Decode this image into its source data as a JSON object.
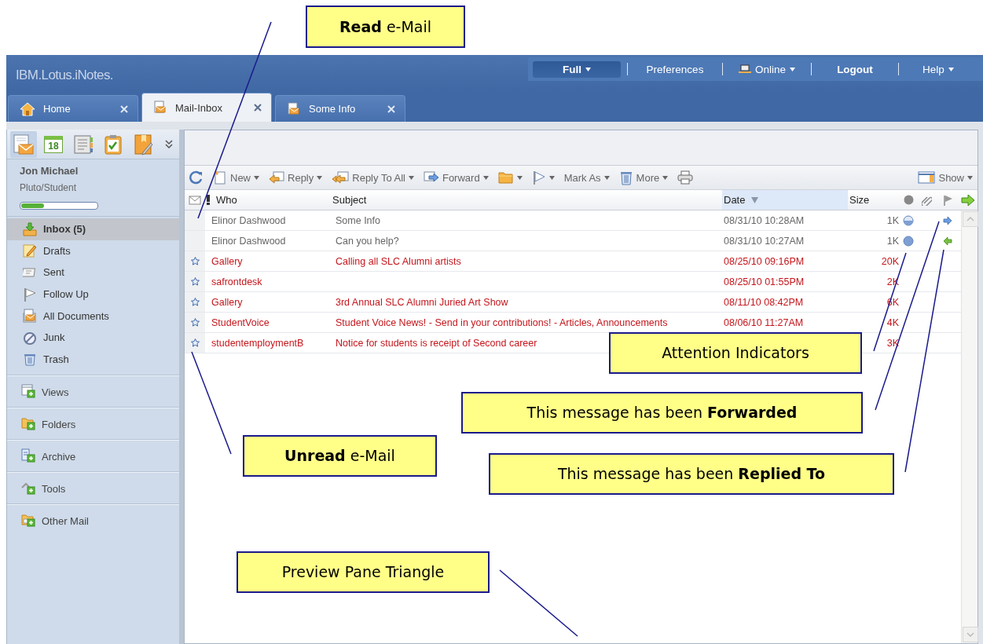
{
  "header": {
    "logo": "IBM.Lotus.iNotes.",
    "nav": [
      {
        "label": "Full",
        "kind": "pill"
      },
      {
        "label": "Preferences",
        "kind": "link"
      },
      {
        "label": "Online",
        "kind": "status"
      },
      {
        "label": "Logout",
        "kind": "strong"
      },
      {
        "label": "Help",
        "kind": "menu"
      }
    ]
  },
  "tabs": [
    {
      "label": "Home",
      "kind": "home",
      "selected": false
    },
    {
      "label": "Mail-Inbox",
      "kind": "mail",
      "selected": true
    },
    {
      "label": "Some Info",
      "kind": "mail",
      "selected": false
    }
  ],
  "sidebar": {
    "apps": [
      {
        "kind": "mail",
        "selected": true
      },
      {
        "kind": "calendar",
        "label": "18",
        "selected": false
      },
      {
        "kind": "contacts",
        "selected": false
      },
      {
        "kind": "todo",
        "selected": false
      },
      {
        "kind": "notebook",
        "selected": false
      }
    ],
    "user": {
      "name": "Jon Michael",
      "org": "Pluto/Student"
    },
    "quota": {
      "level": 0.3
    },
    "nav": [
      {
        "label": "Inbox (5)",
        "kind": "inbox",
        "selected": true
      },
      {
        "label": "Drafts",
        "kind": "drafts",
        "selected": false
      },
      {
        "label": "Sent",
        "kind": "sent",
        "selected": false
      },
      {
        "label": "Follow Up",
        "kind": "followup",
        "selected": false
      },
      {
        "label": "All Documents",
        "kind": "alldocs",
        "selected": false
      },
      {
        "label": "Junk",
        "kind": "junk",
        "selected": false
      },
      {
        "label": "Trash",
        "kind": "trash",
        "selected": false
      }
    ],
    "sections": [
      {
        "label": "Views",
        "kind": "views"
      },
      {
        "label": "Folders",
        "kind": "folders"
      },
      {
        "label": "Archive",
        "kind": "archive"
      },
      {
        "label": "Tools",
        "kind": "tools"
      },
      {
        "label": "Other Mail",
        "kind": "othermail"
      }
    ]
  },
  "toolbar": {
    "items": [
      {
        "kind": "refresh",
        "menu": false
      },
      {
        "kind": "new",
        "label": "New",
        "menu": true
      },
      {
        "kind": "reply",
        "label": "Reply",
        "menu": true
      },
      {
        "kind": "replyall",
        "label": "Reply To All",
        "menu": true
      },
      {
        "kind": "forward",
        "label": "Forward",
        "menu": true
      },
      {
        "kind": "folder",
        "menu": true
      },
      {
        "kind": "flag",
        "menu": true
      },
      {
        "kind": "markas",
        "label": "Mark As",
        "menu": true
      },
      {
        "kind": "delete",
        "label": "More",
        "menu": true
      },
      {
        "kind": "print",
        "menu": false
      }
    ],
    "show": {
      "label": "Show"
    }
  },
  "columns": [
    {
      "label": "Who",
      "kind": "who",
      "sorted": false
    },
    {
      "label": "Subject",
      "kind": "subject",
      "sorted": false
    },
    {
      "label": "Date",
      "kind": "date",
      "sorted": true
    },
    {
      "label": "Size",
      "kind": "size",
      "sorted": false
    }
  ],
  "messages": [
    {
      "who": "Elinor Dashwood",
      "subject": "Some Info",
      "date": "08/31/10 10:28AM",
      "size": "1K",
      "unread": false,
      "attention": {
        "kind": "half"
      },
      "forwarded": true,
      "replied": false
    },
    {
      "who": "Elinor Dashwood",
      "subject": "Can you help?",
      "date": "08/31/10 10:27AM",
      "size": "1K",
      "unread": false,
      "attention": {
        "kind": "full"
      },
      "forwarded": false,
      "replied": true
    },
    {
      "who": "Gallery",
      "subject": "Calling all SLC Alumni artists",
      "date": "08/25/10 09:16PM",
      "size": "20K",
      "unread": true,
      "forwarded": false,
      "replied": false
    },
    {
      "who": "safrontdesk",
      "date": "08/25/10 01:55PM",
      "size": "2K",
      "unread": true,
      "forwarded": false,
      "replied": false
    },
    {
      "who": "Gallery",
      "subject": "3rd Annual SLC Alumni Juried Art Show",
      "date": "08/11/10 08:42PM",
      "size": "6K",
      "unread": true,
      "forwarded": false,
      "replied": false
    },
    {
      "who": "StudentVoice",
      "subject": "Student Voice News! - Send in your contributions! - Articles, Announcements",
      "date": "08/06/10 11:27AM",
      "size": "4K",
      "unread": true,
      "forwarded": false,
      "replied": false
    },
    {
      "who": "studentemploymentB",
      "subject": "Notice for students is receipt of Second career",
      "size": "3K",
      "unread": true,
      "forwarded": false,
      "replied": false
    }
  ],
  "callouts": [
    {
      "text": "**Read** e-Mail"
    },
    {
      "text": "Attention Indicators"
    },
    {
      "text": "This message has been **Forwarded**"
    },
    {
      "text": "This message has been **Replied To**"
    },
    {
      "text": "**Unread** e-Mail"
    },
    {
      "text": "Preview Pane Triangle"
    }
  ]
}
